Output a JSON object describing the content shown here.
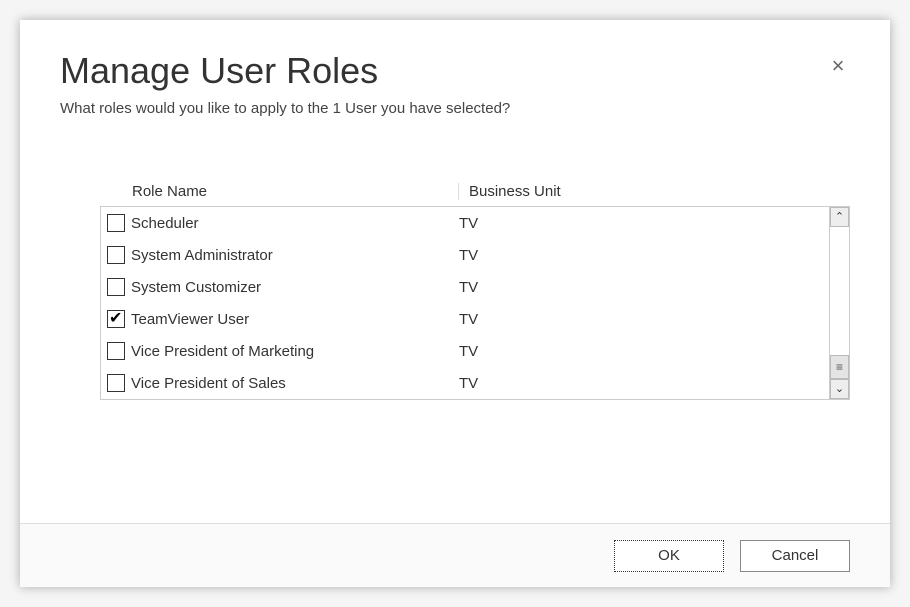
{
  "dialog": {
    "title": "Manage User Roles",
    "subtitle": "What roles would you like to apply to the 1 User you have selected?",
    "close_label": "×"
  },
  "table": {
    "columns": {
      "role": "Role Name",
      "bu": "Business Unit"
    },
    "rows": [
      {
        "checked": false,
        "role": "Scheduler",
        "bu": "TV"
      },
      {
        "checked": false,
        "role": "System Administrator",
        "bu": "TV"
      },
      {
        "checked": false,
        "role": "System Customizer",
        "bu": "TV"
      },
      {
        "checked": true,
        "role": "TeamViewer User",
        "bu": "TV"
      },
      {
        "checked": false,
        "role": "Vice President of Marketing",
        "bu": "TV"
      },
      {
        "checked": false,
        "role": "Vice President of Sales",
        "bu": "TV"
      }
    ]
  },
  "scrollbar": {
    "up": "⌃",
    "thumb": "≡",
    "down": "⌄"
  },
  "footer": {
    "ok_label": "OK",
    "cancel_label": "Cancel"
  }
}
